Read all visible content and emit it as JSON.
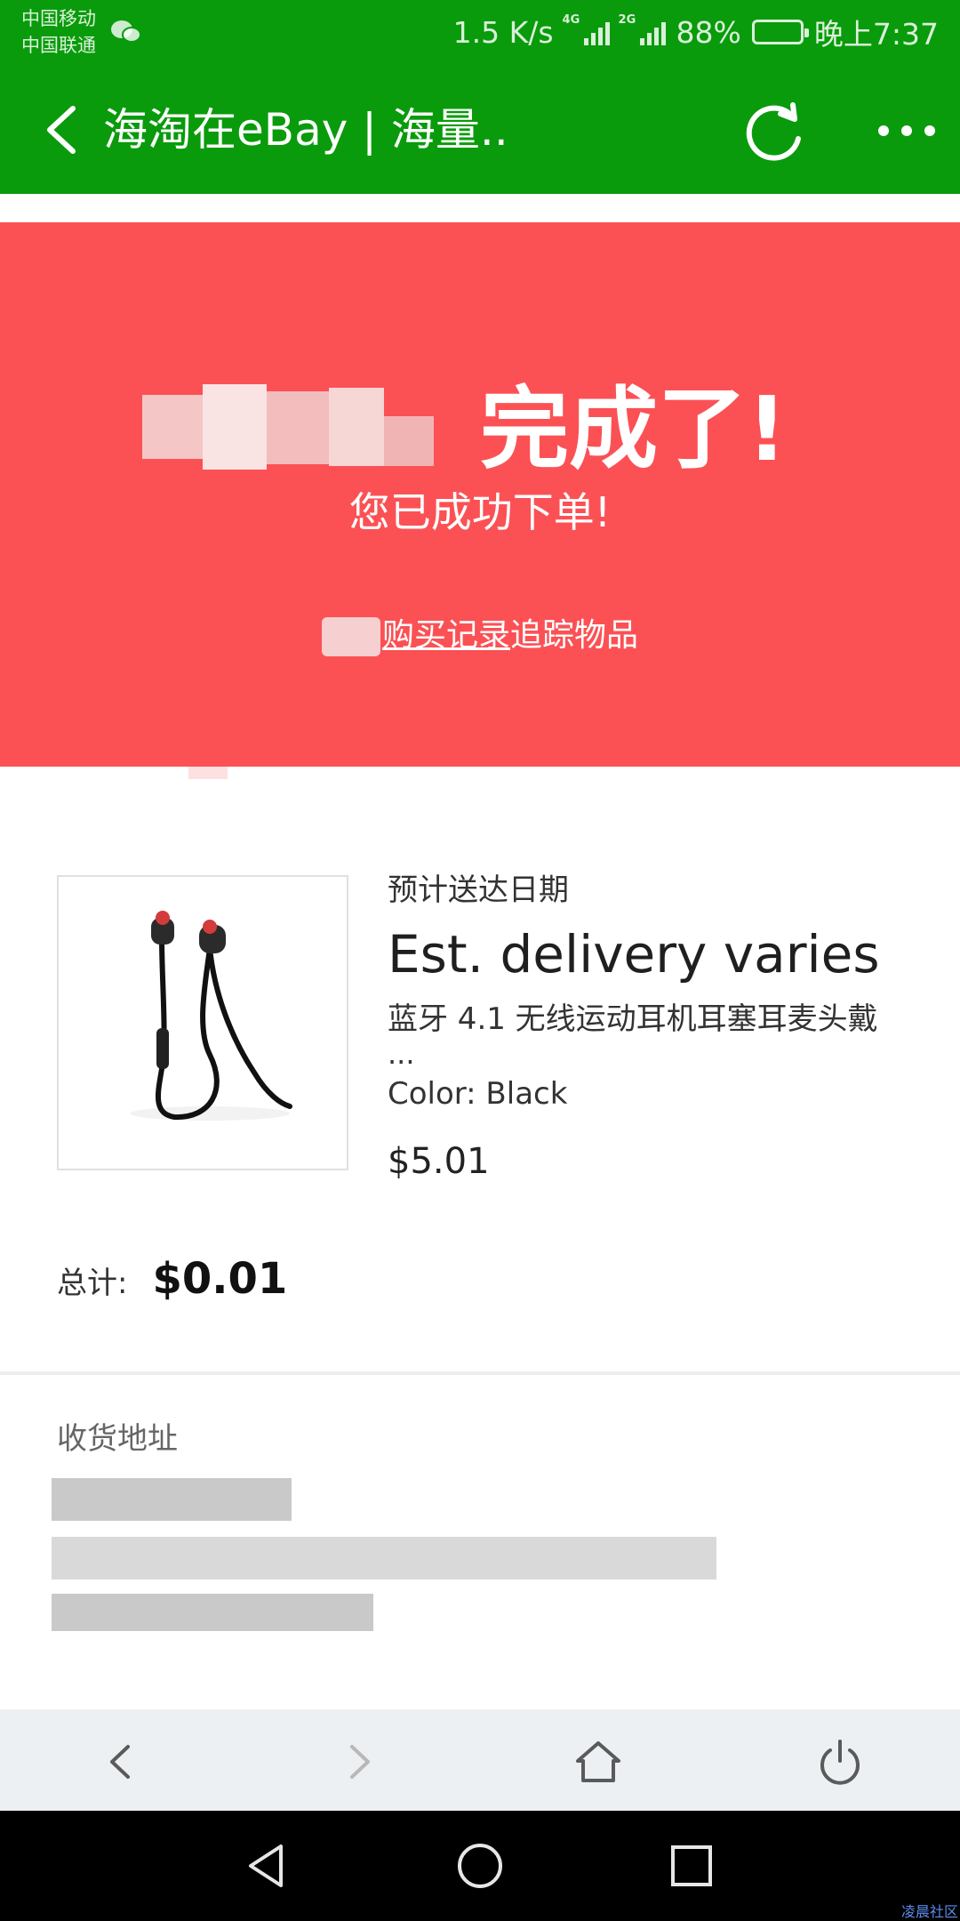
{
  "status_bar": {
    "carrier_1": "中国移动",
    "carrier_2": "中国联通",
    "net_speed": "1.5 K/s",
    "signal_1_tag": "4G",
    "signal_2_tag": "2G",
    "battery": "88%",
    "time": "晚上7:37"
  },
  "title_bar": {
    "title": "海淘在eBay | 海量..",
    "back_icon": "chevron-left-icon",
    "refresh_icon": "refresh-icon",
    "more_icon": "more-dots-icon"
  },
  "hero": {
    "headline": "完成了!",
    "subtitle": "您已成功下单!",
    "link_text": "购买记录",
    "link_suffix": "追踪物品",
    "background": "#fb5155"
  },
  "order": {
    "delivery_label": "预计送达日期",
    "delivery_value": "Est. delivery varies",
    "item_title": "蓝牙 4.1 无线运动耳机耳塞耳麦头戴",
    "item_title_more": "...",
    "item_color": "Color: Black",
    "item_price": "$5.01",
    "total_label": "总计:",
    "total_value": "$0.01"
  },
  "shipping": {
    "label": "收货地址"
  },
  "browser_toolbar": {
    "buttons": [
      "back-arrow-icon",
      "forward-arrow-icon",
      "home-icon",
      "power-icon"
    ]
  },
  "nav_bar": {
    "buttons": [
      "nav-back-triangle-icon",
      "nav-home-circle-icon",
      "nav-recents-square-icon"
    ]
  },
  "watermark": "凌晨社区",
  "colors": {
    "header_green": "#099b0b",
    "hero_red": "#fb5155",
    "toolbar_gray": "#edf0f3"
  }
}
